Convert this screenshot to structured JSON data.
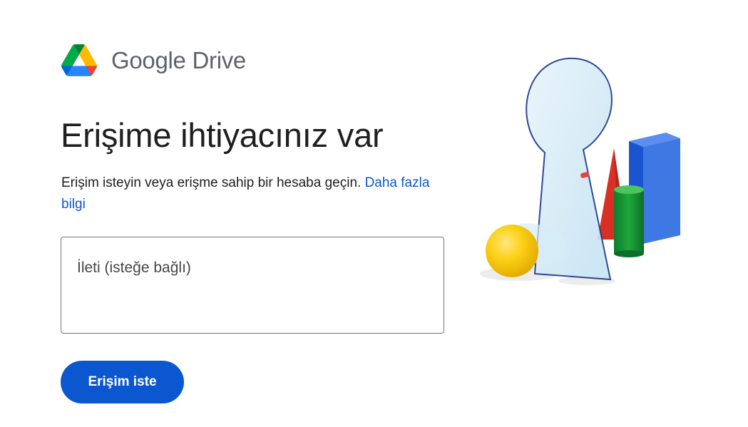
{
  "brand": {
    "logo_icon": "google-drive-logo",
    "name": "Google Drive"
  },
  "main": {
    "title": "Erişime ihtiyacınız var",
    "description": "Erişim isteyin veya erişme sahip bir hesaba geçin.",
    "learn_more_link": "Daha fazla bilgi",
    "message_placeholder": "İleti (isteğe bağlı)",
    "request_button": "Erişim iste"
  },
  "colors": {
    "primary": "#0b57d0",
    "text": "#1f1f1f",
    "brand_text": "#5f6368",
    "border": "#747775"
  },
  "illustration": {
    "icon": "keyhole-with-shapes-illustration"
  }
}
